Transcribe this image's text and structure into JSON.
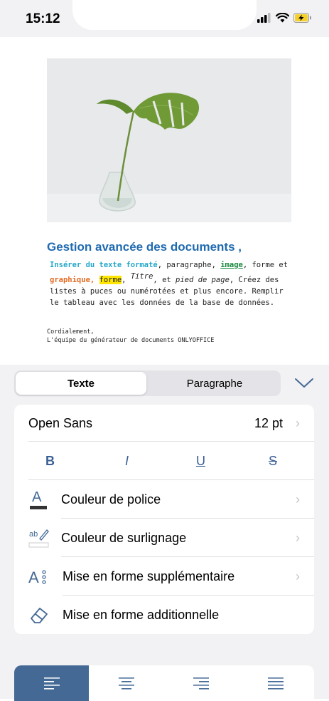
{
  "status_bar": {
    "time": "15:12"
  },
  "document": {
    "title": "Gestion avancée des documents ,",
    "body": {
      "part1": "Insérer du texte formaté",
      "part2": ",  paragraphe, ",
      "part3": "image",
      "part4": ", forme et",
      "part5": "graphique,",
      "part6": " ",
      "part7": "forme",
      "part8": ", ",
      "part9": "Titre",
      "part10": ", et ",
      "part11": "pied de page",
      "part12": ", Créez des listes à puces ou numérotées et plus encore. Remplir le tableau avec les données de la base de données."
    },
    "sign_line1": "Cordialement,",
    "sign_line2": "L'équipe du générateur de documents ONLYOFFICE"
  },
  "panel": {
    "tabs": {
      "text": "Texte",
      "paragraph": "Paragraphe"
    },
    "font": {
      "name": "Open Sans",
      "size": "12 pt"
    },
    "format_buttons": {
      "bold": "B",
      "italic": "I",
      "underline": "U",
      "strike": "S"
    },
    "items": {
      "font_color": "Couleur de police",
      "highlight_color": "Couleur de surlignage",
      "extra_formatting": "Mise en forme supplémentaire",
      "additional_formatting": "Mise en forme additionnelle"
    }
  },
  "colors": {
    "accent": "#446995",
    "title_blue": "#1f6ab0"
  }
}
